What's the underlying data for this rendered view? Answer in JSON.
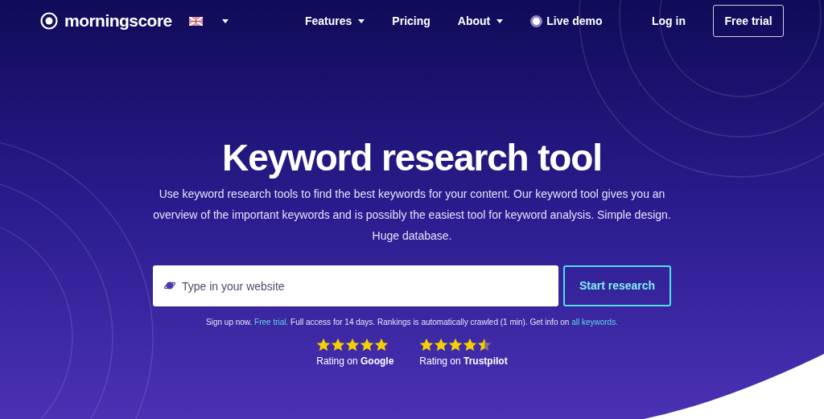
{
  "nav": {
    "logo": "morningscore",
    "items": [
      {
        "label": "Features",
        "kind": "dropdown"
      },
      {
        "label": "Pricing",
        "kind": "link"
      },
      {
        "label": "About",
        "kind": "dropdown"
      },
      {
        "label": "Live demo",
        "kind": "demo"
      }
    ],
    "login": "Log in",
    "cta": "Free trial"
  },
  "hero": {
    "title": "Keyword research tool",
    "description": "Use keyword research tools to find the best keywords for your content. Our keyword tool gives you an overview of the important keywords and is possibly the easiest tool for keyword analysis. Simple design. Huge database.",
    "search": {
      "placeholder": "Type in your website"
    },
    "button": "Start research",
    "note": [
      {
        "kind": "text",
        "text": "Sign up now. "
      },
      {
        "kind": "link",
        "text": "Free trial."
      },
      {
        "kind": "text",
        "text": " Full access for 14 days. Rankings is automatically crawled (1 min). Get info on "
      },
      {
        "kind": "link",
        "text": "all keywords."
      }
    ],
    "ratings": [
      {
        "stars": 5,
        "label": "Rating on **Google**"
      },
      {
        "stars": 4.5,
        "label": "Rating on **Trustpilot**"
      }
    ]
  }
}
